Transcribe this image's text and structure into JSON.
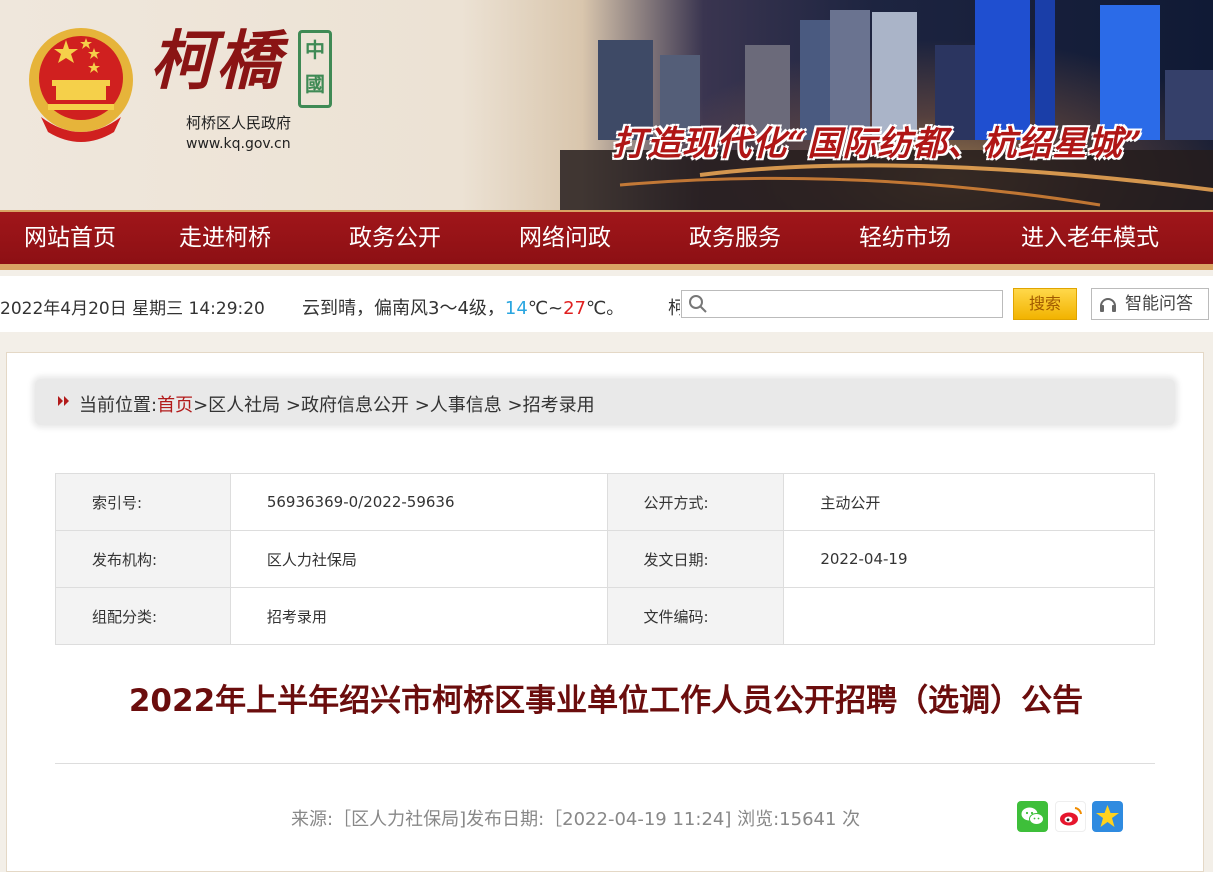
{
  "header": {
    "logo_text": "柯橋",
    "seal_text": "中國",
    "gov_name": "柯桥区人民政府",
    "gov_url": "www.kq.gov.cn",
    "slogan": "打造现代化“国际纺都、杭绍星城”"
  },
  "nav": {
    "items": [
      "网站首页",
      "走进柯桥",
      "政务公开",
      "网络问政",
      "政务服务",
      "轻纺市场",
      "进入老年模式"
    ]
  },
  "infobar": {
    "datetime": "2022年4月20日 星期三 14:29:20",
    "weather_prefix": "云到晴，偏南风3～4级，",
    "temp_low": "14",
    "temp_sep": "℃~",
    "temp_high": "27",
    "temp_suffix": "℃。",
    "ticker_fragment": "柯",
    "search_placeholder": "",
    "search_button": "搜索",
    "qa_button": "智能问答"
  },
  "breadcrumb": {
    "prefix": "当前位置:",
    "home": "首页",
    "items": [
      ">区人社局",
      " >政府信息公开",
      " >人事信息",
      " >招考录用"
    ]
  },
  "meta": {
    "index_label": "索引号:",
    "index_value": "56936369-0/2022-59636",
    "open_label": "公开方式:",
    "open_value": "主动公开",
    "publisher_label": "发布机构:",
    "publisher_value": "区人力社保局",
    "date_label": "发文日期:",
    "date_value": "2022-04-19",
    "category_label": "组配分类:",
    "category_value": "招考录用",
    "docno_label": "文件编码:",
    "docno_value": ""
  },
  "article": {
    "title": "2022年上半年绍兴市柯桥区事业单位工作人员公开招聘（选调）公告",
    "source_line": "来源:［区人力社保局]发布日期:［2022-04-19 11:24] 浏览:15641 次"
  },
  "colors": {
    "nav_red": "#a0161a",
    "title_red": "#6b0d0d",
    "temp_low": "#2aa6e0",
    "temp_high": "#e02020"
  },
  "icons": {
    "emblem": "national-emblem-icon",
    "search": "search-icon",
    "qa": "headset-icon",
    "crumb": "double-chevron-icon",
    "share": [
      "wechat-icon",
      "weibo-icon",
      "qzone-icon"
    ]
  }
}
